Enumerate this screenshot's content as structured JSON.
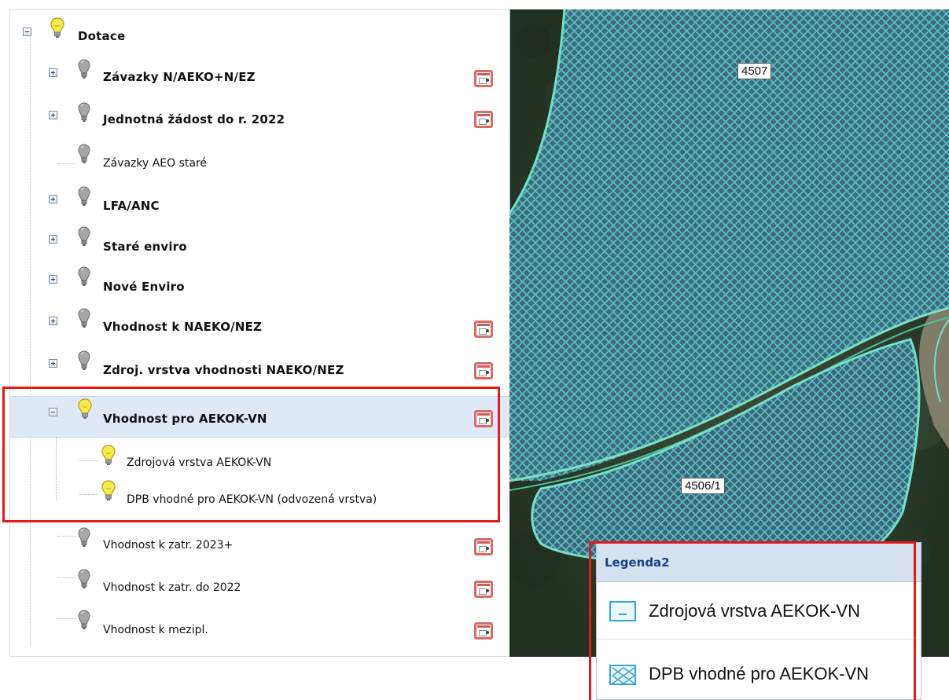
{
  "tree": {
    "root": {
      "label": "Dotace"
    },
    "items": [
      {
        "label": "Závazky N/AEKO+N/EZ"
      },
      {
        "label": "Jednotná žádost do r. 2022"
      },
      {
        "label": "Závazky AEO staré"
      },
      {
        "label": "LFA/ANC"
      },
      {
        "label": "Staré enviro"
      },
      {
        "label": "Nové Enviro"
      },
      {
        "label": "Vhodnost k NAEKO/NEZ"
      },
      {
        "label": "Zdroj. vrstva vhodnosti NAEKO/NEZ"
      },
      {
        "label": "Vhodnost pro AEKOK-VN"
      },
      {
        "label": "Zdrojová vrstva AEKOK-VN"
      },
      {
        "label": "DPB vhodné pro AEKOK-VN (odvozená vrstva)"
      },
      {
        "label": "Vhodnost k zatr. 2023+"
      },
      {
        "label": "Vhodnost k zatr. do 2022"
      },
      {
        "label": "Vhodnost k mezipl."
      }
    ]
  },
  "map": {
    "parcels": [
      "4507",
      "4506/1"
    ]
  },
  "legend": {
    "title": "Legenda2",
    "items": [
      {
        "label": "Zdrojová vrstva AEKOK-VN"
      },
      {
        "label": "DPB vhodné pro AEKOK-VN"
      }
    ]
  },
  "colors": {
    "highlight": "#e41a1a",
    "bulb_on": "#f4e33a",
    "bulb_off": "#8c8c8c",
    "selected_row": "#dfe8f6",
    "legend_header": "#d6e2f1",
    "parcel_hatch": "#57c7d9"
  }
}
